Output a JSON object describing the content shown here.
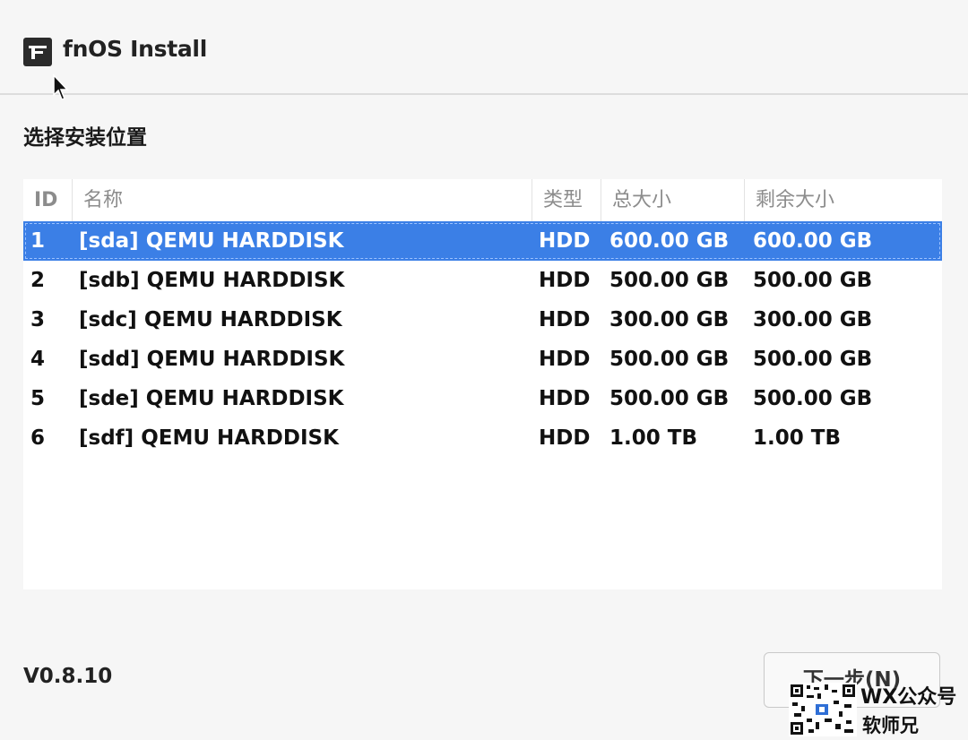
{
  "window": {
    "title": "fnOS Install"
  },
  "section": {
    "title": "选择安装位置"
  },
  "table": {
    "headers": {
      "id": "ID",
      "name": "名称",
      "type": "类型",
      "total": "总大小",
      "free": "剩余大小"
    },
    "selected_index": 0,
    "rows": [
      {
        "id": "1",
        "name": "[sda] QEMU HARDDISK",
        "type": "HDD",
        "total": "600.00 GB",
        "free": "600.00 GB"
      },
      {
        "id": "2",
        "name": "[sdb] QEMU HARDDISK",
        "type": "HDD",
        "total": "500.00 GB",
        "free": "500.00 GB"
      },
      {
        "id": "3",
        "name": "[sdc] QEMU HARDDISK",
        "type": "HDD",
        "total": "300.00 GB",
        "free": "300.00 GB"
      },
      {
        "id": "4",
        "name": "[sdd] QEMU HARDDISK",
        "type": "HDD",
        "total": "500.00 GB",
        "free": "500.00 GB"
      },
      {
        "id": "5",
        "name": "[sde] QEMU HARDDISK",
        "type": "HDD",
        "total": "500.00 GB",
        "free": "500.00 GB"
      },
      {
        "id": "6",
        "name": "[sdf] QEMU HARDDISK",
        "type": "HDD",
        "total": "1.00 TB",
        "free": "1.00 TB"
      }
    ]
  },
  "footer": {
    "version": "V0.8.10",
    "next_label": "下一步(N)"
  },
  "watermark": {
    "line1": "WX公众号",
    "line2": "软师兄"
  },
  "colors": {
    "selection": "#3b7fe6",
    "background": "#f6f6f6",
    "panel": "#ffffff"
  },
  "icons": {
    "app": "fnos-logo-icon",
    "cursor": "mouse-pointer-icon"
  }
}
